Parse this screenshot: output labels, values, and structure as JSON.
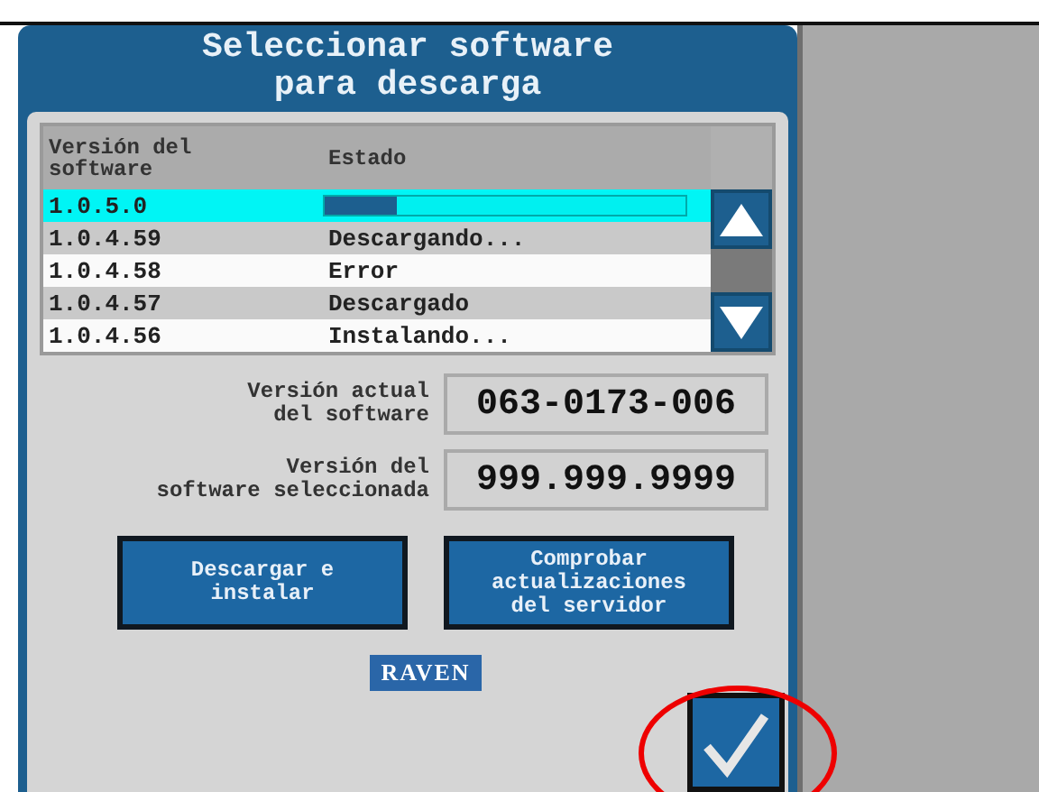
{
  "dialog": {
    "title": "Seleccionar software\npara descarga"
  },
  "table": {
    "columns": [
      "Versión del\nsoftware",
      "Estado"
    ],
    "rows": [
      {
        "version": "1.0.5.0",
        "kind": "progress",
        "level": 0.2,
        "selected": true
      },
      {
        "version": "1.0.4.59",
        "kind": "text",
        "status": "Descargando...",
        "selected": false
      },
      {
        "version": "1.0.4.58",
        "kind": "text",
        "status": "Error",
        "selected": false
      },
      {
        "version": "1.0.4.57",
        "kind": "text",
        "status": "Descargado",
        "selected": false
      },
      {
        "version": "1.0.4.56",
        "kind": "text",
        "status": "Instalando...",
        "selected": false
      }
    ]
  },
  "fields": [
    {
      "label": "Versión actual\ndel software",
      "value": "063-0173-006"
    },
    {
      "label": "Versión del\nsoftware seleccionada",
      "value": "999.999.9999"
    }
  ],
  "buttons": [
    "Descargar e\ninstalar",
    "Comprobar\nactualizaciones\ndel servidor"
  ],
  "logo": "RAVEN"
}
